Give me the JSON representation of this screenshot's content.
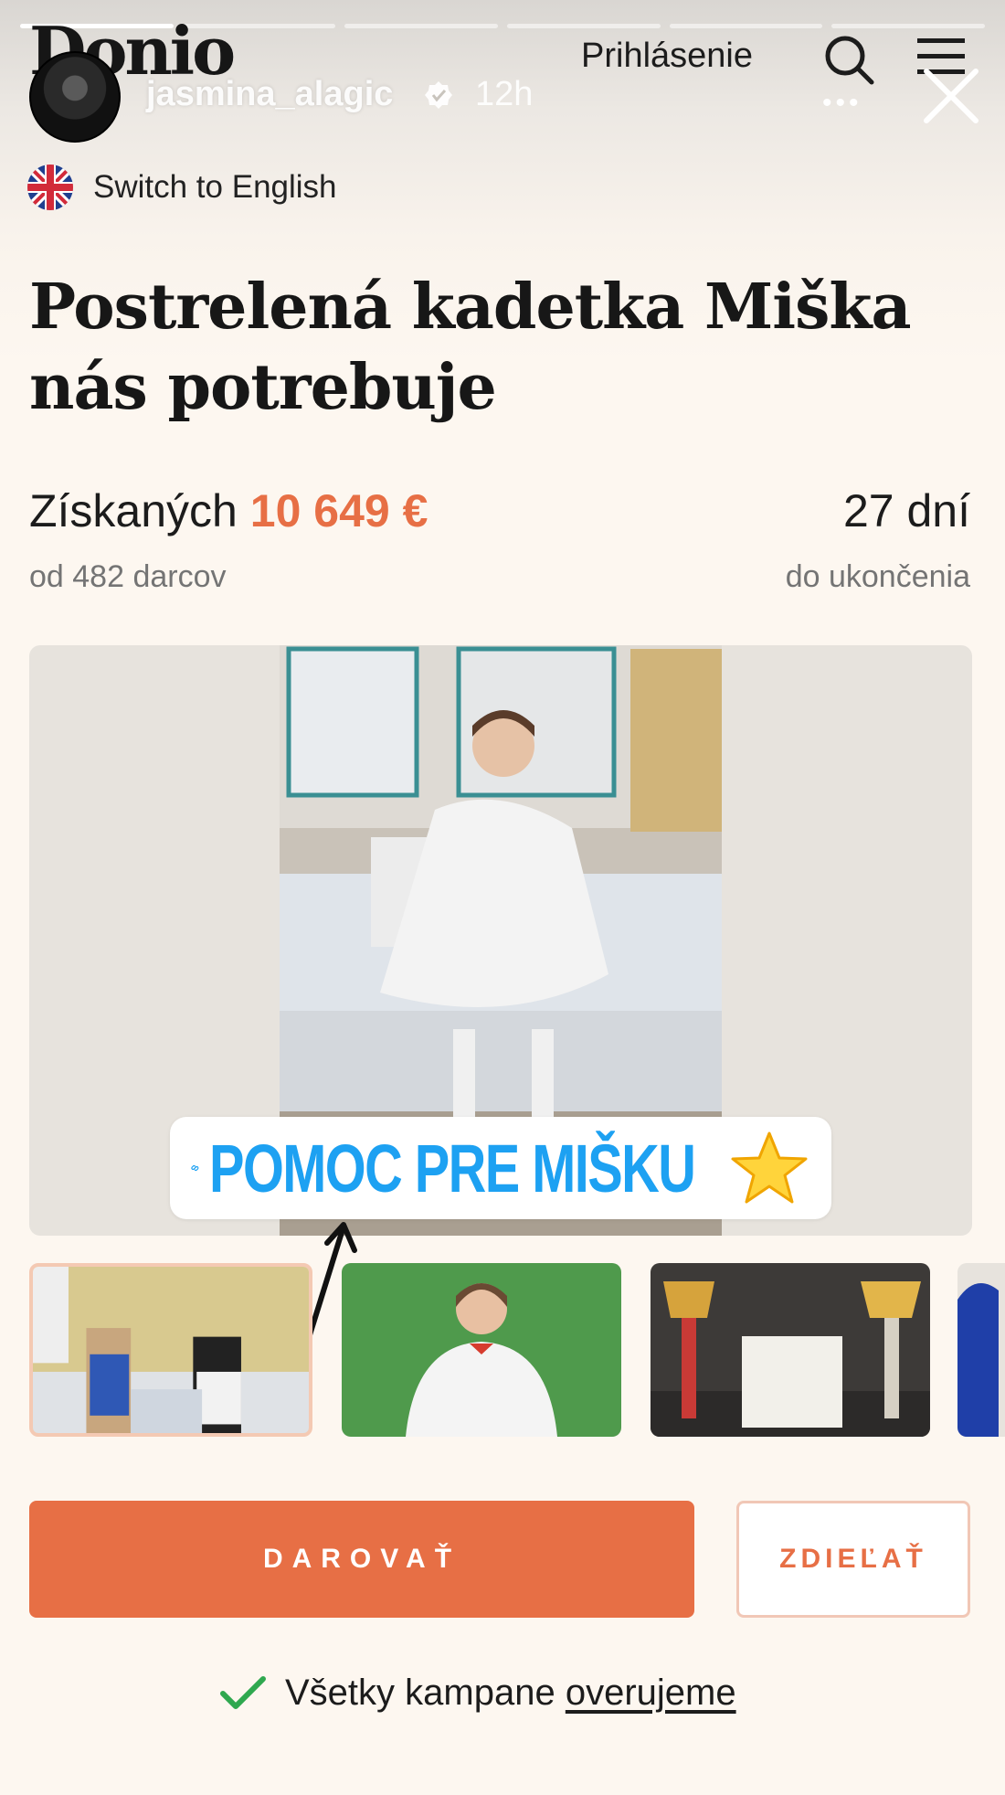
{
  "story": {
    "username": "jasmina_alagic",
    "time": "12h",
    "segments": 6,
    "active_segment": 1
  },
  "site": {
    "logo": "Donio",
    "login_label": "Prihlásenie"
  },
  "language": {
    "label": "Switch to English"
  },
  "campaign": {
    "title": "Postrelená kadetka Miška nás potrebuje",
    "raised_label": "Získaných",
    "raised_amount": "10 649 €",
    "donors": "od 482 darcov",
    "days_left": "27 dní",
    "days_label": "do ukončenia"
  },
  "sticker": {
    "link_text": "POMOC PRE MIŠKU"
  },
  "actions": {
    "donate": "DAROVAŤ",
    "share": "ZDIEĽAŤ"
  },
  "verify": {
    "text": "Všetky kampane",
    "link": "overujeme"
  },
  "colors": {
    "accent": "#e76f45",
    "link_blue": "#1da1f2",
    "check_green": "#2fa84f"
  }
}
